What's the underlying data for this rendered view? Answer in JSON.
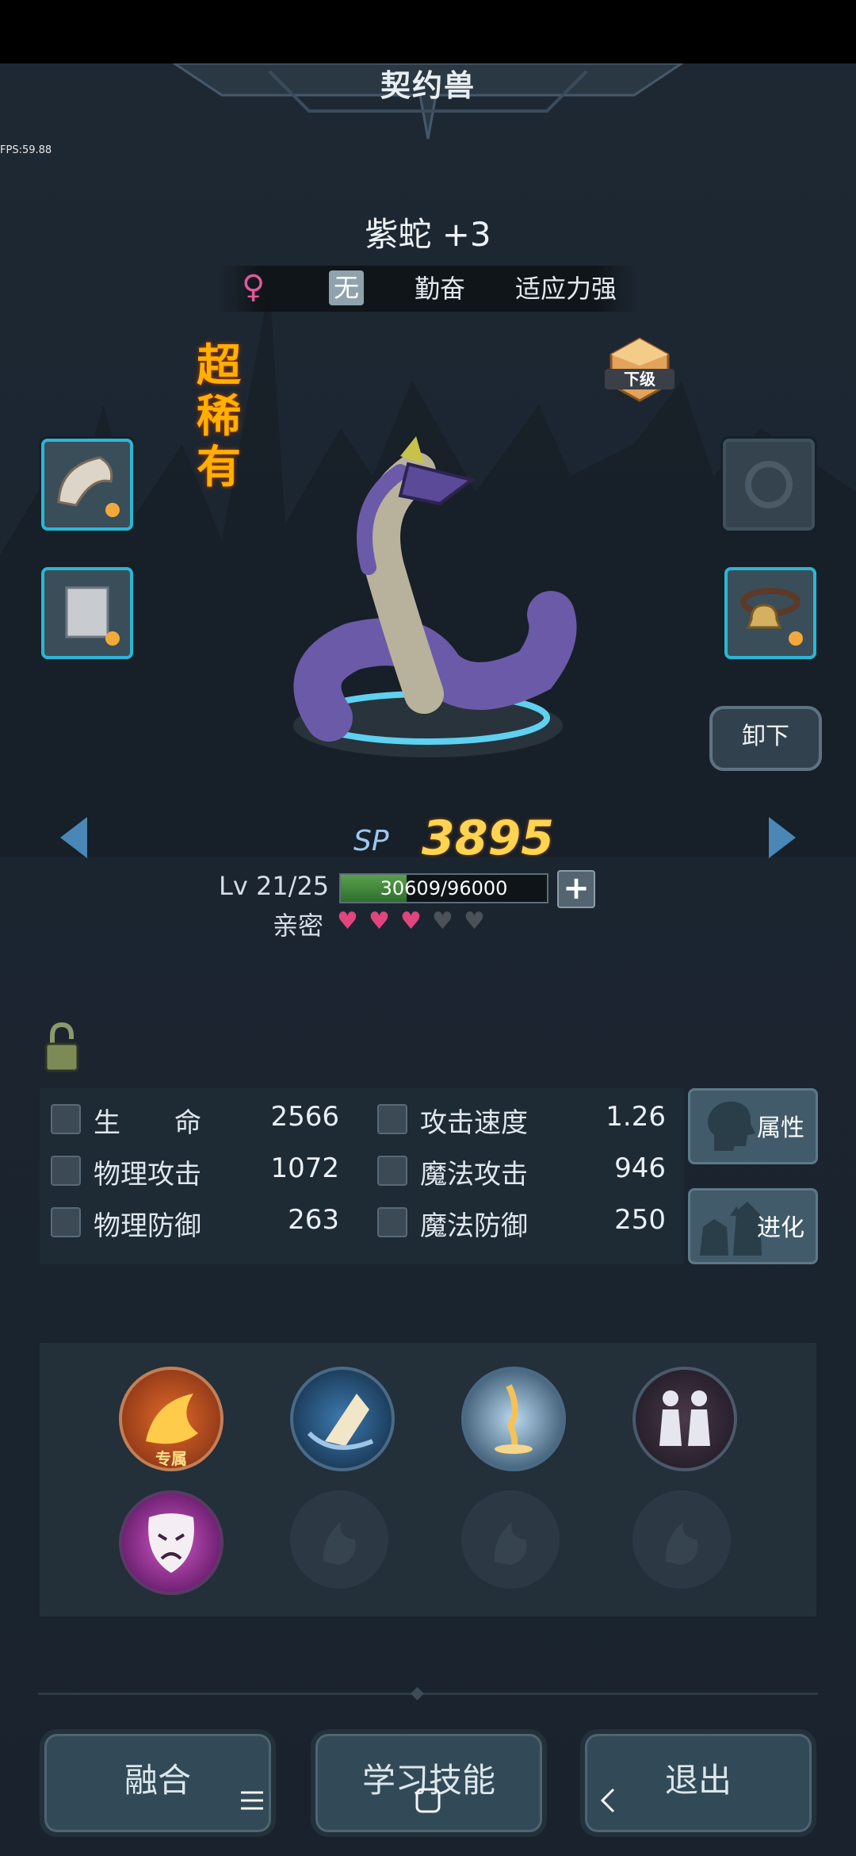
{
  "header": {
    "title": "契约兽"
  },
  "fps": "FPS:59.88",
  "pet": {
    "name": "紫蛇 +3",
    "gender_symbol": "♀",
    "element": "无",
    "traits": [
      "勤奋",
      "适应力强"
    ],
    "rarity": "超稀有",
    "grade": "下级"
  },
  "actions": {
    "unequip": "卸下"
  },
  "progress": {
    "sp_label": "SP",
    "sp_value": "3895",
    "level": "Lv 21/25",
    "xp_text": "30609/96000",
    "xp_fraction": 0.319,
    "intimacy_label": "亲密",
    "intimacy_hearts": 3,
    "intimacy_max": 5
  },
  "stats": [
    {
      "name": "生　　命",
      "value": "2566",
      "icon": "heart-shield-icon"
    },
    {
      "name": "攻击速度",
      "value": "1.26",
      "icon": "boot-speed-icon"
    },
    {
      "name": "物理攻击",
      "value": "1072",
      "icon": "sword-icon"
    },
    {
      "name": "魔法攻击",
      "value": "946",
      "icon": "wand-icon"
    },
    {
      "name": "物理防御",
      "value": "263",
      "icon": "shield-icon"
    },
    {
      "name": "魔法防御",
      "value": "250",
      "icon": "magic-shield-icon"
    }
  ],
  "side_buttons": {
    "attributes": "属性",
    "evolve": "进化"
  },
  "skills": {
    "exclusive_label": "专属",
    "slots": [
      {
        "icon": "fire-claw-icon",
        "state": "equipped"
      },
      {
        "icon": "wind-slash-icon",
        "state": "equipped"
      },
      {
        "icon": "light-pillar-icon",
        "state": "equipped"
      },
      {
        "icon": "twin-figures-icon",
        "state": "equipped"
      },
      {
        "icon": "crying-mask-icon",
        "state": "equipped"
      },
      {
        "icon": "empty-skill-icon",
        "state": "empty"
      },
      {
        "icon": "empty-skill-icon",
        "state": "empty"
      },
      {
        "icon": "empty-skill-icon",
        "state": "empty"
      }
    ]
  },
  "bottom": {
    "fuse": "融合",
    "learn": "学习技能",
    "exit": "退出"
  },
  "colors": {
    "accent_cyan": "#2bb6d4",
    "sp_gold": "#ffd452",
    "rarity_orange": "#ffb000",
    "heart_pink": "#e0457e"
  }
}
